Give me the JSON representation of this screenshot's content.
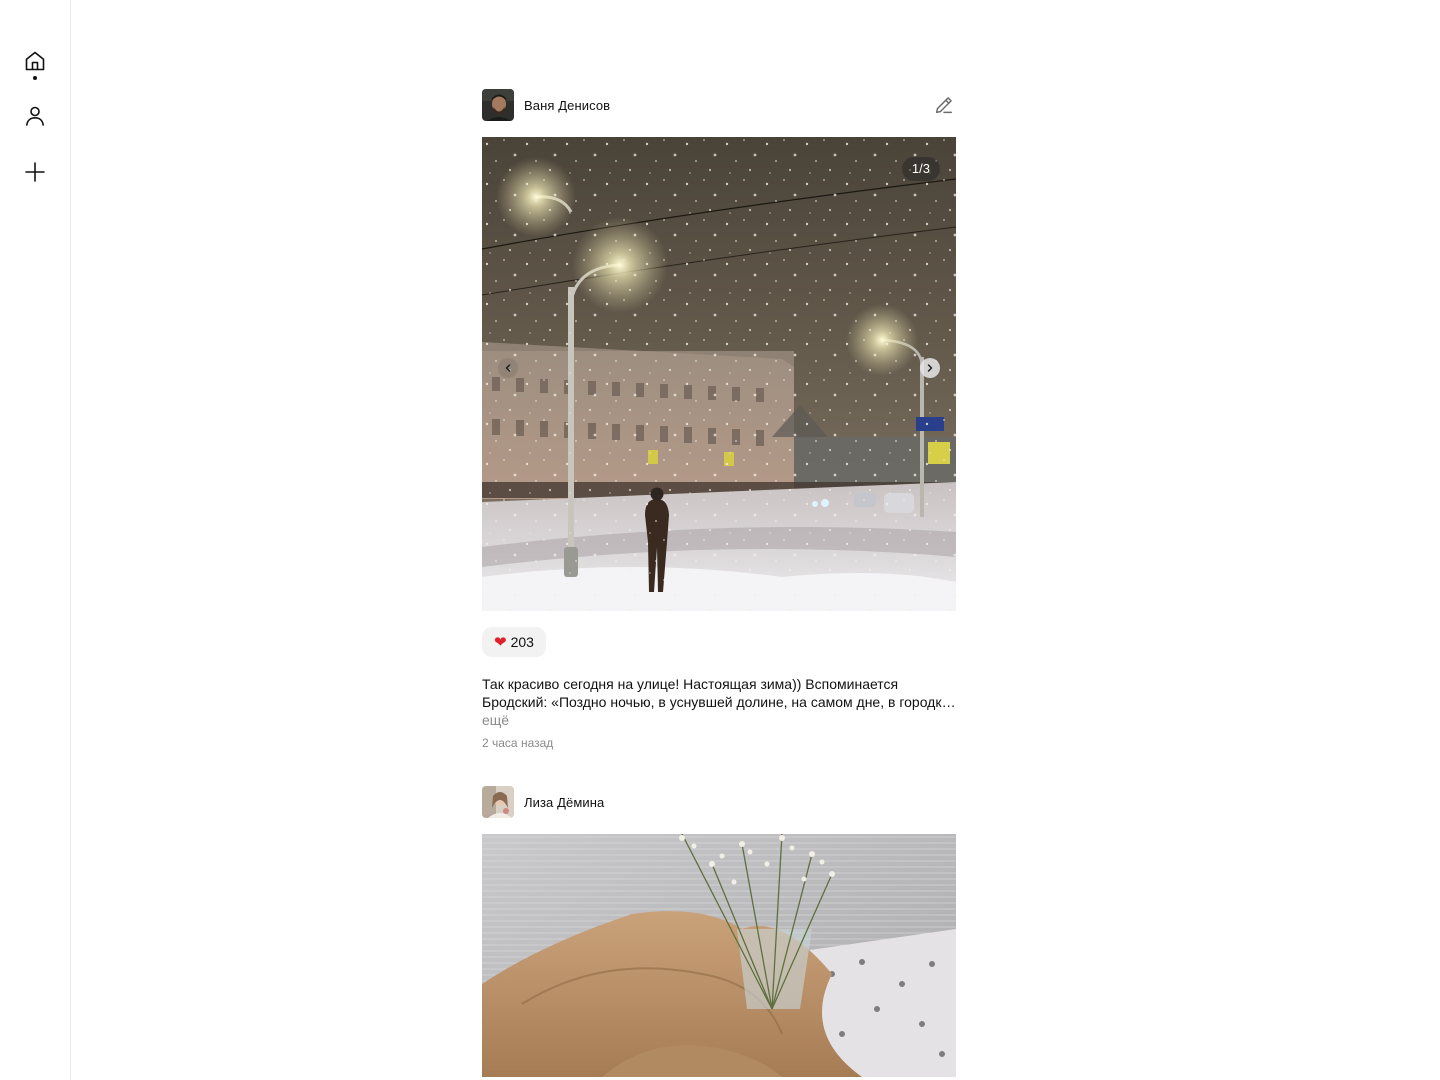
{
  "sidebar": {
    "items": [
      {
        "name": "home",
        "icon": "home-icon",
        "active": true
      },
      {
        "name": "profile",
        "icon": "user-icon",
        "active": false
      },
      {
        "name": "create",
        "icon": "plus-icon",
        "active": false
      }
    ]
  },
  "posts": [
    {
      "author": "Ваня Денисов",
      "photo_counter": "1/3",
      "likes": "203",
      "like_icon": "heart-icon",
      "caption": "Так красиво сегодня на улице! Настоящая зима)) Вспоминается Бродский: «Поздно ночью, в уснувшей долине, на самом дне, в городке, занесенном снегом по ручку двери…»",
      "more_label": "ещё",
      "time": "2 часа назад"
    },
    {
      "author": "Лиза Дёмина"
    }
  ],
  "colors": {
    "accent_like": "#e0202c",
    "muted_text": "#8a8a8a",
    "pill_bg": "#f2f2f2"
  }
}
